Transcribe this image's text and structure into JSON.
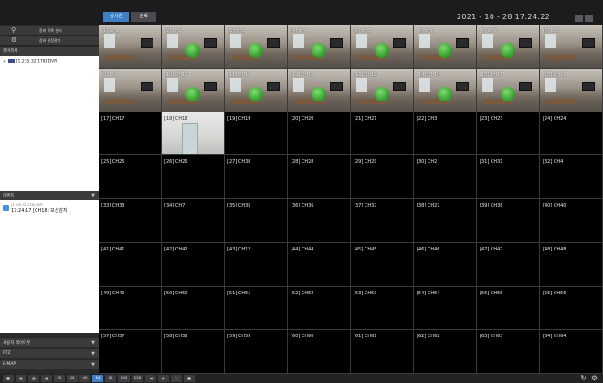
{
  "topbar": {
    "tabs": [
      {
        "label": "실시간"
      },
      {
        "label": "검색"
      }
    ],
    "datetime": "2021 - 10 - 28 17:24:22"
  },
  "sidebar": {
    "menu": [
      {
        "label": "장비 목록 관리",
        "icon": "search-icon"
      },
      {
        "label": "장비 설정관리",
        "icon": "gear-icon"
      }
    ],
    "device_tree_title": "장비목록",
    "device_tree_item": "[1.235.32.178] DVR",
    "event_title": "이벤트",
    "event_item_sub": "[1.235.32.178] DVR",
    "event_item_main": "17:24:17 [CH18] 모션감지",
    "bottom_sections": [
      {
        "label": "사용자 레이아웃"
      },
      {
        "label": "PTZ"
      },
      {
        "label": "E-MAP"
      }
    ]
  },
  "grid": {
    "cells": [
      "[1] CH1",
      "[2] CH2",
      "[3] CH3",
      "[4] CH4",
      "[5] CH5",
      "[6] CH6",
      "[7] CH7",
      "[8] CH8",
      "[9] CH9",
      "[10] CH10",
      "[11] CH11",
      "[12] CH12",
      "[13] CH13",
      "[14] CH14",
      "[15] CH15",
      "[16] CH16",
      "[17] CH17",
      "[18] CH18",
      "[19] CH19",
      "[20] CH20",
      "[21] CH21",
      "[22] CH3",
      "[23] CH23",
      "[24] CH24",
      "[25] CH25",
      "[26] CH26",
      "[27] CH38",
      "[28] CH28",
      "[29] CH29",
      "[30] CH2",
      "[31] CH31",
      "[32] CH4",
      "[33] CH33",
      "[34] CH7",
      "[35] CH35",
      "[36] CH36",
      "[37] CH37",
      "[38] CH27",
      "[39] CH38",
      "[40] CH40",
      "[41] CH41",
      "[42] CH42",
      "[43] CH12",
      "[44] CH44",
      "[45] CH45",
      "[46] CH46",
      "[47] CH47",
      "[48] CH48",
      "[49] CH49",
      "[50] CH50",
      "[51] CH51",
      "[52] CH52",
      "[53] CH53",
      "[54] CH54",
      "[55] CH55",
      "[56] CH56",
      "[57] CH57",
      "[58] CH58",
      "[59] CH59",
      "[60] CH60",
      "[61] CH61",
      "[62] CH62",
      "[63] CH63",
      "[64] CH64"
    ]
  },
  "bottombar": {
    "layout_buttons": [
      "25",
      "36",
      "49",
      "64",
      "81",
      "100",
      "128"
    ],
    "active_layout": "64"
  },
  "colors": {
    "accent": "#3f7fc5",
    "background": "#1a1a1c",
    "sidebar": "#2a2a2c"
  }
}
